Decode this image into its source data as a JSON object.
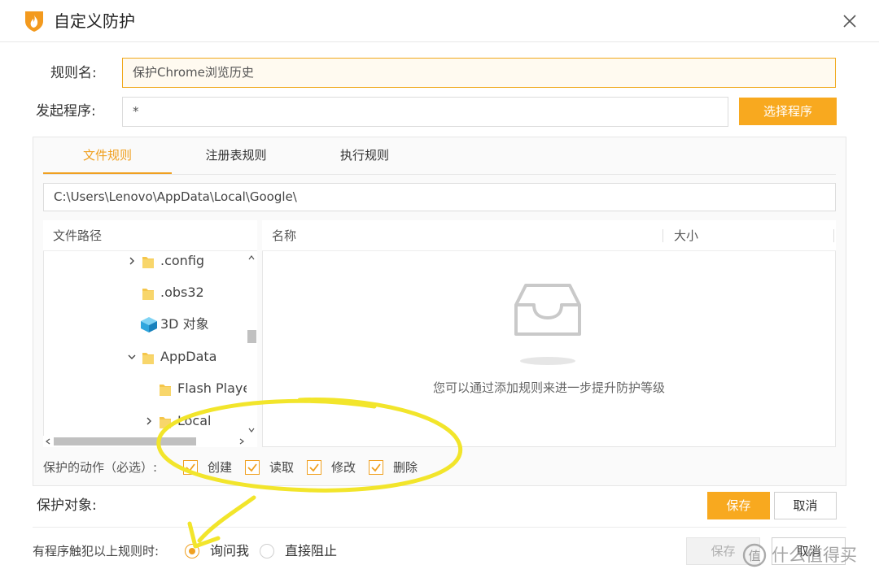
{
  "window": {
    "title": "自定义防护",
    "logo_icon": "shield-flame-icon",
    "close_icon": "close-icon"
  },
  "form": {
    "rule_name_label": "规则名:",
    "rule_name_value": "保护Chrome浏览历史",
    "launcher_label": "发起程序:",
    "launcher_value": "*",
    "select_program_label": "选择程序"
  },
  "tabs": [
    {
      "label": "文件规则",
      "active": true
    },
    {
      "label": "注册表规则",
      "active": false
    },
    {
      "label": "执行规则",
      "active": false
    }
  ],
  "path_bar": "C:\\Users\\Lenovo\\AppData\\Local\\Google\\",
  "tree": {
    "header": "文件路径",
    "items": [
      {
        "label": ".config",
        "expand": "collapsed",
        "icon": "folder-icon",
        "indent": 0
      },
      {
        "label": ".obs32",
        "expand": "none",
        "icon": "folder-icon",
        "indent": 0
      },
      {
        "label": "3D 对象",
        "expand": "none",
        "icon": "3d-objects-icon",
        "indent": 0
      },
      {
        "label": "AppData",
        "expand": "expanded",
        "icon": "folder-icon",
        "indent": 0
      },
      {
        "label": "Flash Playe",
        "expand": "none",
        "icon": "folder-icon",
        "indent": 1
      },
      {
        "label": "Local",
        "expand": "collapsed",
        "icon": "folder-icon",
        "indent": 1
      }
    ]
  },
  "list": {
    "columns": [
      "名称",
      "大小"
    ],
    "empty_icon": "empty-inbox-icon",
    "empty_text": "您可以通过添加规则来进一步提升防护等级"
  },
  "actions": {
    "label": "保护的动作（必选）:",
    "items": [
      {
        "label": "创建",
        "checked": true
      },
      {
        "label": "读取",
        "checked": true
      },
      {
        "label": "修改",
        "checked": true
      },
      {
        "label": "删除",
        "checked": true
      }
    ]
  },
  "protect_target": {
    "label": "保护对象:",
    "save_label": "保存",
    "cancel_label": "取消"
  },
  "trigger": {
    "label": "有程序触犯以上规则时:",
    "options": [
      {
        "label": "询问我",
        "selected": true
      },
      {
        "label": "直接阻止",
        "selected": false
      }
    ]
  },
  "footer": {
    "save_label": "保存",
    "cancel_label": "取消",
    "watermark": "什么值得买"
  },
  "colors": {
    "accent": "#f8a91f",
    "annotation": "#f2e52b"
  }
}
